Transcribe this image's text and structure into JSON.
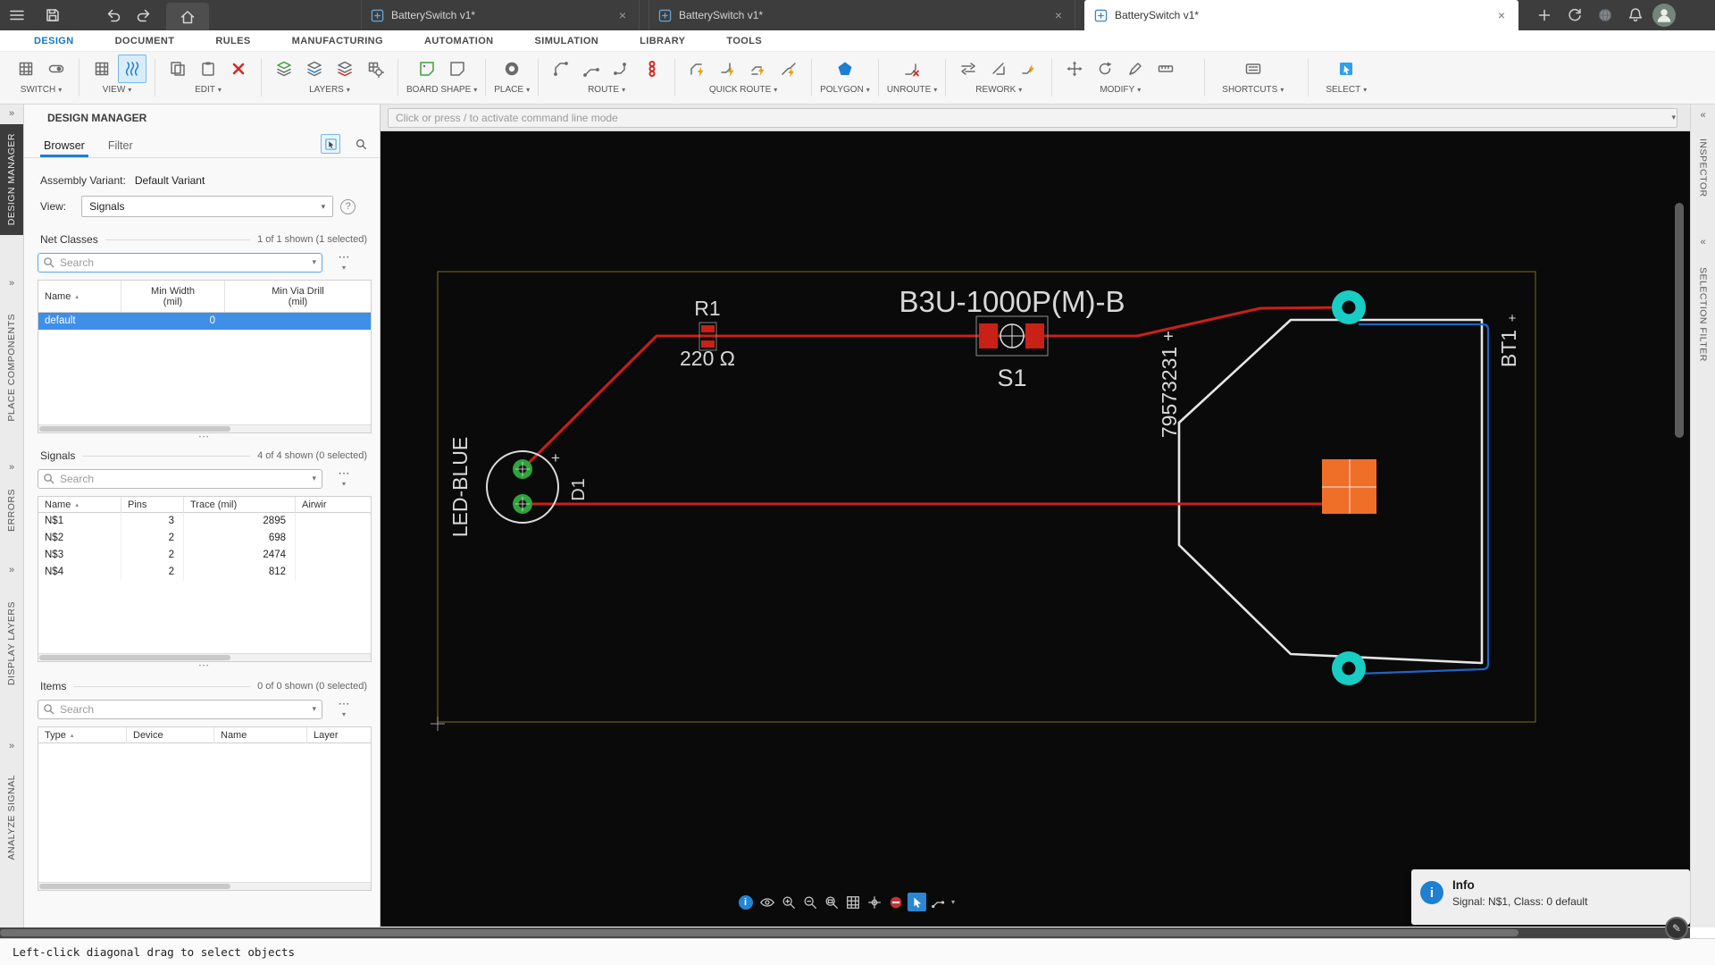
{
  "titlebar": {
    "tabs": [
      {
        "title": "BatterySwitch v1*"
      },
      {
        "title": "BatterySwitch v1*"
      },
      {
        "title": "BatterySwitch v1*"
      }
    ]
  },
  "menubar": {
    "items": [
      "DESIGN",
      "DOCUMENT",
      "RULES",
      "MANUFACTURING",
      "AUTOMATION",
      "SIMULATION",
      "LIBRARY",
      "TOOLS"
    ]
  },
  "ribbon": {
    "groups": [
      {
        "label": "SWITCH"
      },
      {
        "label": "VIEW"
      },
      {
        "label": "EDIT"
      },
      {
        "label": "LAYERS"
      },
      {
        "label": "BOARD SHAPE"
      },
      {
        "label": "PLACE"
      },
      {
        "label": "ROUTE"
      },
      {
        "label": "QUICK ROUTE"
      },
      {
        "label": "POLYGON"
      },
      {
        "label": "UNROUTE"
      },
      {
        "label": "REWORK"
      },
      {
        "label": "MODIFY"
      },
      {
        "label": "SHORTCUTS"
      },
      {
        "label": "SELECT"
      }
    ]
  },
  "command_line": {
    "placeholder": "Click or press / to activate command line mode"
  },
  "left_dock": {
    "panels": [
      "DESIGN MANAGER",
      "PLACE COMPONENTS",
      "ERRORS",
      "DISPLAY LAYERS",
      "ANALYZE SIGNAL"
    ]
  },
  "right_dock": {
    "panels": [
      "INSPECTOR",
      "SELECTION FILTER"
    ]
  },
  "design_manager": {
    "title": "DESIGN MANAGER",
    "tab_browser": "Browser",
    "tab_filter": "Filter",
    "assembly_variant_label": "Assembly Variant:",
    "assembly_variant_value": "Default Variant",
    "view_label": "View:",
    "view_value": "Signals",
    "net_classes": {
      "title": "Net Classes",
      "count": "1 of 1 shown (1 selected)",
      "search_placeholder": "Search",
      "col_name": "Name",
      "col_min_width_1": "Min Width",
      "col_min_width_2": "(mil)",
      "col_min_via_1": "Min Via Drill",
      "col_min_via_2": "(mil)",
      "rows": [
        {
          "name": "default",
          "min_width": "0",
          "min_via_drill": ""
        }
      ]
    },
    "signals": {
      "title": "Signals",
      "count": "4 of 4 shown (0 selected)",
      "search_placeholder": "Search",
      "col_name": "Name",
      "col_pins": "Pins",
      "col_trace": "Trace (mil)",
      "col_airwire": "Airwir",
      "rows": [
        {
          "name": "N$1",
          "pins": "3",
          "trace": "2895"
        },
        {
          "name": "N$2",
          "pins": "2",
          "trace": "698"
        },
        {
          "name": "N$3",
          "pins": "2",
          "trace": "2474"
        },
        {
          "name": "N$4",
          "pins": "2",
          "trace": "812"
        }
      ]
    },
    "items": {
      "title": "Items",
      "count": "0 of 0 shown (0 selected)",
      "search_placeholder": "Search",
      "col_type": "Type",
      "col_device": "Device",
      "col_name": "Name",
      "col_layer": "Layer"
    }
  },
  "pcb": {
    "part_top": "B3U-1000P(M)-B",
    "r1": "R1",
    "r1_value": "220 Ω",
    "s1": "S1",
    "led": "LED-BLUE",
    "d1": "D1",
    "battery_part": "79573231",
    "bt1": "BT1",
    "plus": "+"
  },
  "info_popup": {
    "title": "Info",
    "text": "Signal: N$1, Class: 0 default"
  },
  "status_bar": {
    "text": "Left-click diagonal drag to select objects"
  },
  "colors": {
    "accent": "#1c7fd1",
    "trace_red": "#c92018",
    "pad_teal": "#17cdc4",
    "square_orange": "#f06f28",
    "outline_blue": "#2263c4",
    "board_outline": "#e6e6e6"
  }
}
